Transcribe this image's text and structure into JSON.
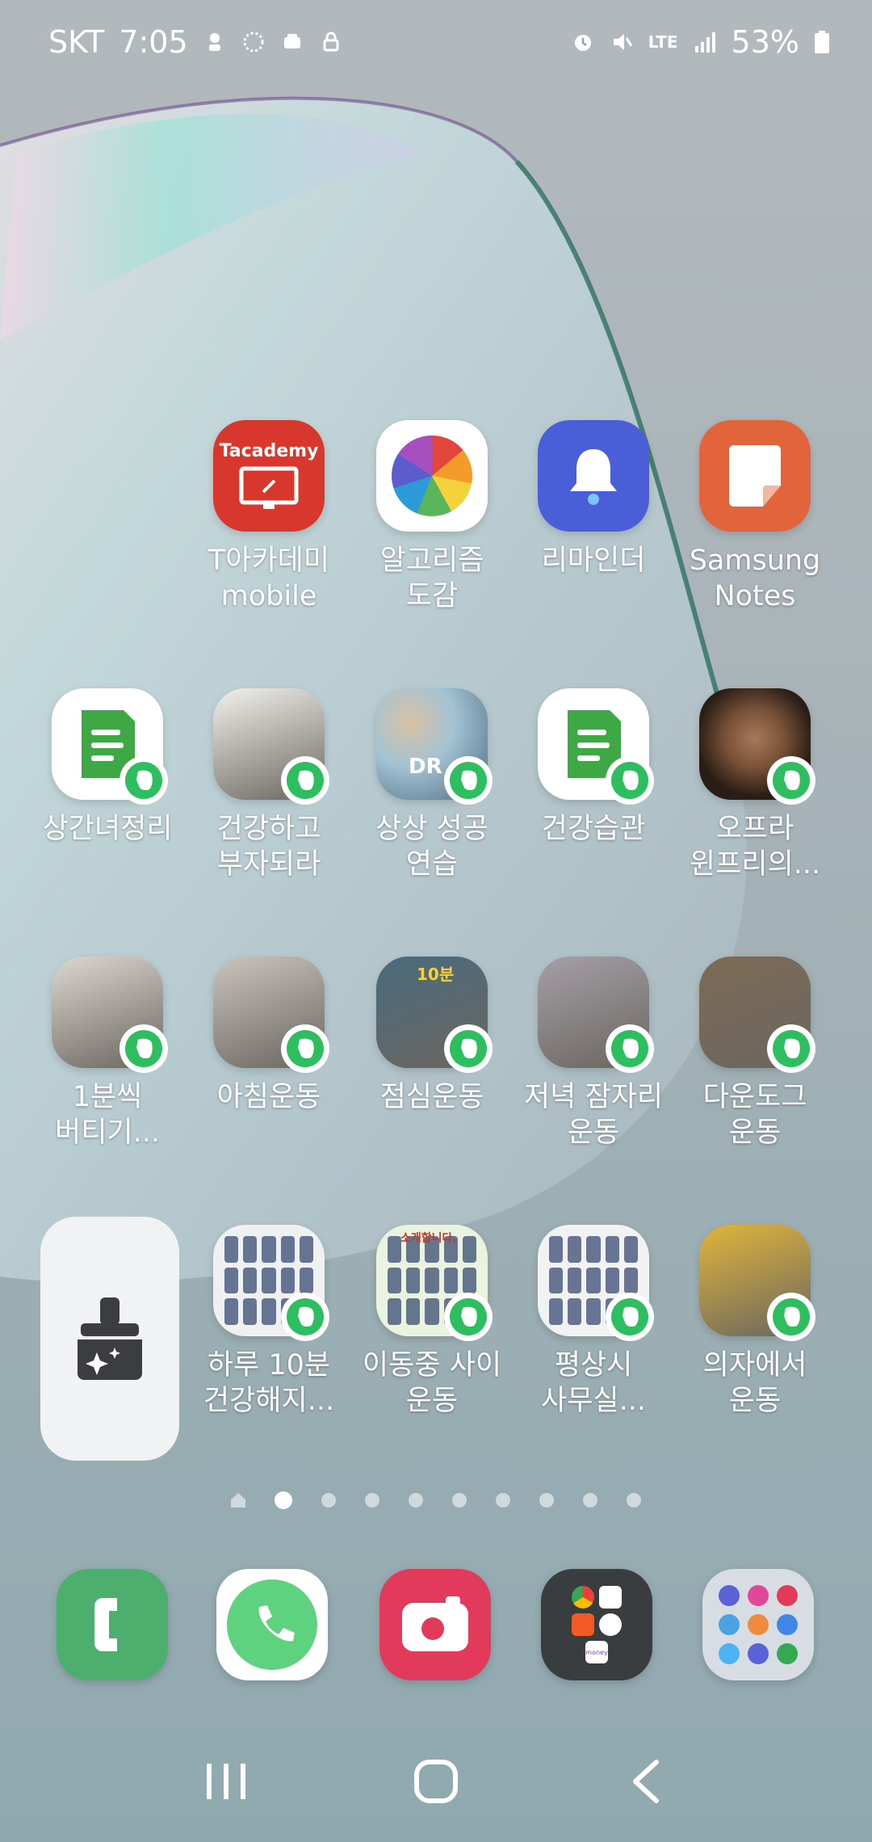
{
  "status_bar": {
    "carrier": "SKT",
    "time": "7:05",
    "battery": "53%",
    "network": "LTE"
  },
  "apps": [
    {
      "label": "T아카데미\nmobile",
      "icon": "tacademy-icon",
      "color": "#d8372d",
      "icon_text": "Tacademy"
    },
    {
      "label": "알고리즘\n도감",
      "icon": "algorithm-icon",
      "color": "#ffffff"
    },
    {
      "label": "리마인더",
      "icon": "bell-icon",
      "color": "#4a5ed8"
    },
    {
      "label": "Samsung\nNotes",
      "icon": "notes-icon",
      "color": "#e2643a"
    },
    {
      "label": "상간녀정리",
      "icon": "evernote-note-icon",
      "color": "#ffffff"
    },
    {
      "label": "건강하고\n부자되라",
      "icon": "handwriting-thumbnail-icon",
      "color": "#f3f1ec"
    },
    {
      "label": "상상 성공\n연습",
      "icon": "balloons-thumbnail-icon",
      "color": "#6c8aa7",
      "icon_text": "DR"
    },
    {
      "label": "건강습관",
      "icon": "evernote-note-icon",
      "color": "#ffffff"
    },
    {
      "label": "오프라\n윈프리의...",
      "icon": "portrait-thumbnail-icon",
      "color": "#3a2b22"
    },
    {
      "label": "1분씩\n버티기...",
      "icon": "exercise-photo-icon",
      "color": "#dcd7d0"
    },
    {
      "label": "아침운동",
      "icon": "exercise-photo-icon",
      "color": "#c9c4bd"
    },
    {
      "label": "점심운동",
      "icon": "exercise-photo-icon",
      "color": "#4a6b7d",
      "icon_text": "10분"
    },
    {
      "label": "저녁 잠자리\n운동",
      "icon": "exercise-photo-icon",
      "color": "#a59fa7"
    },
    {
      "label": "다운도그\n운동",
      "icon": "exercise-photo-icon",
      "color": "#7d6b55"
    },
    {
      "label": "하루 10분\n건강해지...",
      "icon": "exercise-chart-icon",
      "color": "#eef0f2"
    },
    {
      "label": "이동중 사이\n운동",
      "icon": "exercise-chart-icon",
      "color": "#eaf3df",
      "icon_text": "소개합니다."
    },
    {
      "label": "평상시\n사무실...",
      "icon": "exercise-chart-icon",
      "color": "#f1f2f2"
    },
    {
      "label": "의자에서\n운동",
      "icon": "exercise-photo-icon",
      "color": "#e0b53c"
    }
  ],
  "dock": [
    {
      "name": "phone-app",
      "icon": "phone-icon",
      "color": "#4caf6e"
    },
    {
      "name": "call-app",
      "icon": "call-icon",
      "color": "#ffffff"
    },
    {
      "name": "camera-app",
      "icon": "camera-icon",
      "color": "#e23a5a"
    },
    {
      "name": "google-folder",
      "icon": "folder-icon",
      "color": "#3a3d40",
      "icon_text": "money"
    },
    {
      "name": "apps-drawer",
      "icon": "apps-icon",
      "color": "#cfd6dc"
    }
  ],
  "pager": {
    "pages": 9,
    "active_page": 1
  },
  "nav": [
    "recent-apps",
    "home",
    "back"
  ]
}
